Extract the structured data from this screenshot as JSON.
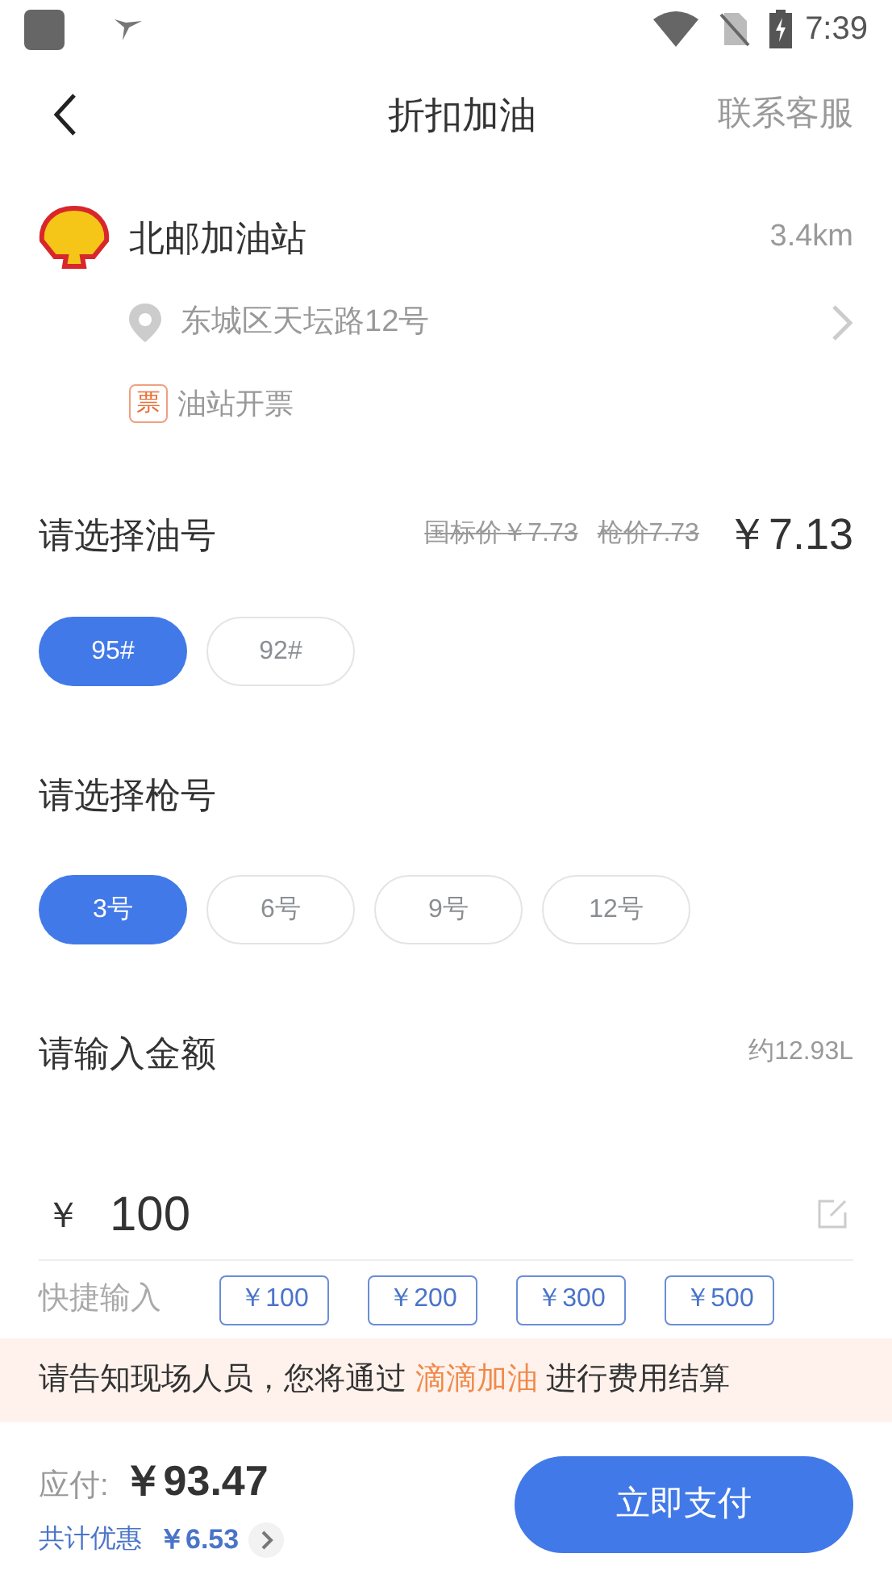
{
  "status_bar": {
    "time": "7:39"
  },
  "header": {
    "title": "折扣加油",
    "action": "联系客服"
  },
  "station": {
    "name": "北邮加油站",
    "distance": "3.4km",
    "address": "东城区天坛路12号",
    "invoice_badge": "票",
    "invoice_label": "油站开票"
  },
  "fuel": {
    "heading": "请选择油号",
    "national_price": "国标价￥7.73",
    "pump_price": "枪价7.73",
    "price": "￥7.13",
    "options": [
      {
        "label": "95#",
        "selected": true
      },
      {
        "label": "92#",
        "selected": false
      }
    ]
  },
  "gun": {
    "heading": "请选择枪号",
    "options": [
      {
        "label": "3号",
        "selected": true
      },
      {
        "label": "6号",
        "selected": false
      },
      {
        "label": "9号",
        "selected": false
      },
      {
        "label": "12号",
        "selected": false
      }
    ]
  },
  "amount": {
    "heading": "请输入金额",
    "liters": "约12.93L",
    "currency": "￥",
    "value": "100",
    "quick_label": "快捷输入",
    "quick_options": [
      "￥100",
      "￥200",
      "￥300",
      "￥500"
    ]
  },
  "notice": {
    "before": "请告知现场人员，您将通过 ",
    "highlight": "滴滴加油",
    "after": " 进行费用结算"
  },
  "footer": {
    "due_label": "应付:",
    "due_amount": "￥93.47",
    "discount_label": "共计优惠",
    "discount_amount": "￥6.53",
    "pay_button": "立即支付"
  }
}
